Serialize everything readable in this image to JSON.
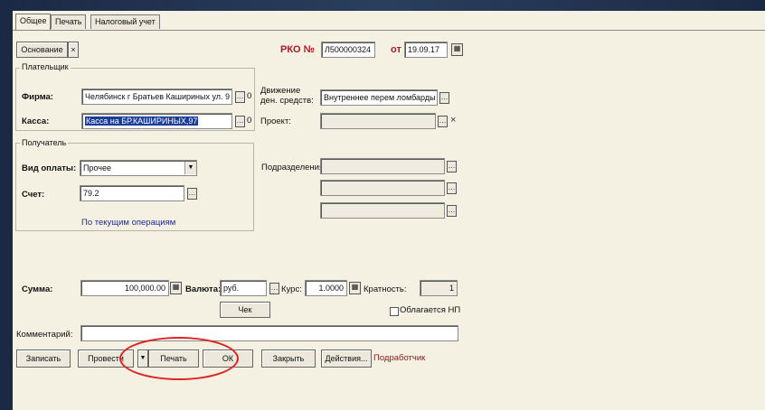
{
  "tabs": [
    {
      "label": "Общее"
    },
    {
      "label": "Печать"
    },
    {
      "label": "Налоговый учет"
    }
  ],
  "header": {
    "basis_button": "Основание",
    "doc_type": "РКО №",
    "doc_number": "Л500000324",
    "date_prefix": "от",
    "date": "19.09.17"
  },
  "payer": {
    "group_title": "Плательщик",
    "firm_label": "Фирма:",
    "firm_value": "Челябинск г Братьев Кашириных ул. 9",
    "firm_num": "0",
    "cash_label": "Касса:",
    "cash_value": "Касса на БР.КАШИРИНЫХ,97",
    "cash_num": "0"
  },
  "movement": {
    "label_line1": "Движение",
    "label_line2": "ден. средств:",
    "value": "Внутреннее перем ломбарды",
    "project_label": "Проект:",
    "project_value": ""
  },
  "recipient": {
    "group_title": "Получатель",
    "payment_type_label": "Вид оплаты:",
    "payment_type_value": "Прочее",
    "account_label": "Счет:",
    "account_value": "79.2",
    "link": "По текущим операциям"
  },
  "subdivision": {
    "label": "Подразделения:",
    "values": [
      "",
      "",
      ""
    ]
  },
  "amount": {
    "sum_label": "Сумма:",
    "sum_value": "100,000.00",
    "currency_label": "Валюта:",
    "currency_value": "руб.",
    "rate_label": "Курс:",
    "rate_value": "1.0000",
    "multiplicity_label": "Кратность:",
    "multiplicity_value": "1"
  },
  "check_button": "Чек",
  "tax_checkbox": "Облагается НП",
  "comment": {
    "label": "Комментарий:",
    "value": ""
  },
  "footer": {
    "record": "Записать",
    "post": "Провести",
    "print": "Печать",
    "ok": "ОК",
    "close": "Закрыть",
    "actions": "Действия...",
    "author": "Подработчик"
  },
  "colors": {
    "window_bg": "#f4f0e2",
    "selection": "#1a3c9a",
    "link": "#1f2a9a",
    "author": "#8b1a1a",
    "highlight_circle": "#e02020"
  }
}
